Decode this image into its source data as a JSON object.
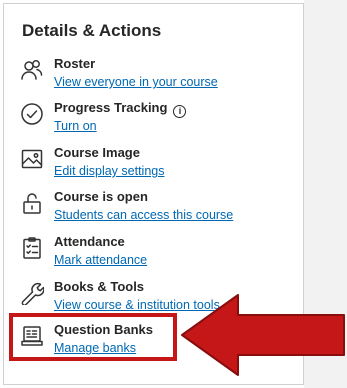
{
  "panel": {
    "title": "Details & Actions",
    "items": [
      {
        "icon": "roster-icon",
        "title": "Roster",
        "link": "View everyone in your course"
      },
      {
        "icon": "progress-tracking-icon",
        "title": "Progress Tracking",
        "info_icon": "info-icon",
        "link": "Turn on"
      },
      {
        "icon": "course-image-icon",
        "title": "Course Image",
        "link": "Edit display settings"
      },
      {
        "icon": "unlock-icon",
        "title": "Course is open",
        "link": "Students can access this course"
      },
      {
        "icon": "attendance-icon",
        "title": "Attendance",
        "link": "Mark attendance"
      },
      {
        "icon": "wrench-icon",
        "title": "Books & Tools",
        "link": "View course & institution tools"
      },
      {
        "icon": "question-banks-icon",
        "title": "Question Banks",
        "link": "Manage banks"
      }
    ]
  },
  "annotation": {
    "highlight_color": "#c51718",
    "arrow_color": "#c51718",
    "arrow_points_to": "Question Banks"
  },
  "colors": {
    "link": "#0068b3",
    "text": "#262626",
    "panel_border": "#d0d0d0"
  }
}
